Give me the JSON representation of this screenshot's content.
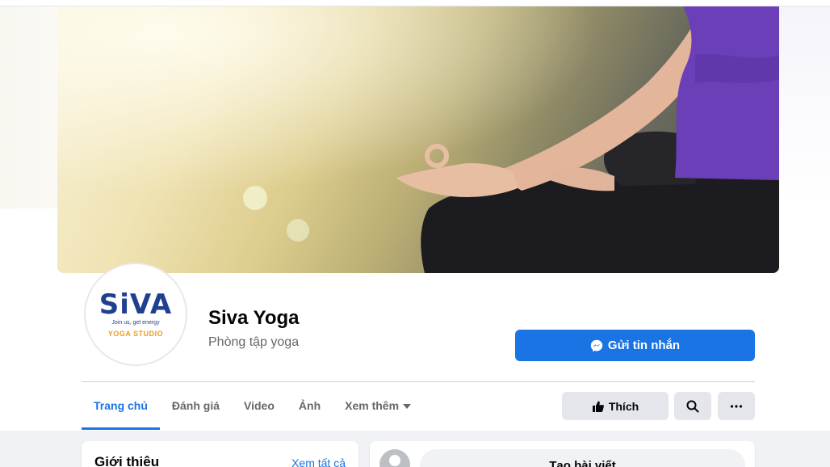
{
  "page": {
    "name": "Siva Yoga",
    "category": "Phòng tập yoga"
  },
  "logo": {
    "main": "SiVA",
    "tagline": "Join us, get energy",
    "studio": "YOGA STUDIO"
  },
  "actions": {
    "message_label": "Gửi tin nhắn",
    "like_label": "Thích"
  },
  "tabs": [
    {
      "label": "Trang chủ",
      "active": true
    },
    {
      "label": "Đánh giá",
      "active": false
    },
    {
      "label": "Video",
      "active": false
    },
    {
      "label": "Ảnh",
      "active": false
    },
    {
      "label": "Xem thêm",
      "active": false
    }
  ],
  "intro": {
    "title": "Giới thiệu",
    "see_all": "Xem tất cả"
  },
  "composer": {
    "label": "Tạo bài viết"
  },
  "colors": {
    "accent": "#1b74e4",
    "secondary_text": "#65676b",
    "button_gray": "#e4e6eb",
    "logo_blue": "#1f3f8f",
    "logo_orange": "#f29a1f"
  },
  "icons": [
    "messenger-icon",
    "thumbs-up-icon",
    "search-icon",
    "more-icon",
    "chevron-down-icon"
  ]
}
